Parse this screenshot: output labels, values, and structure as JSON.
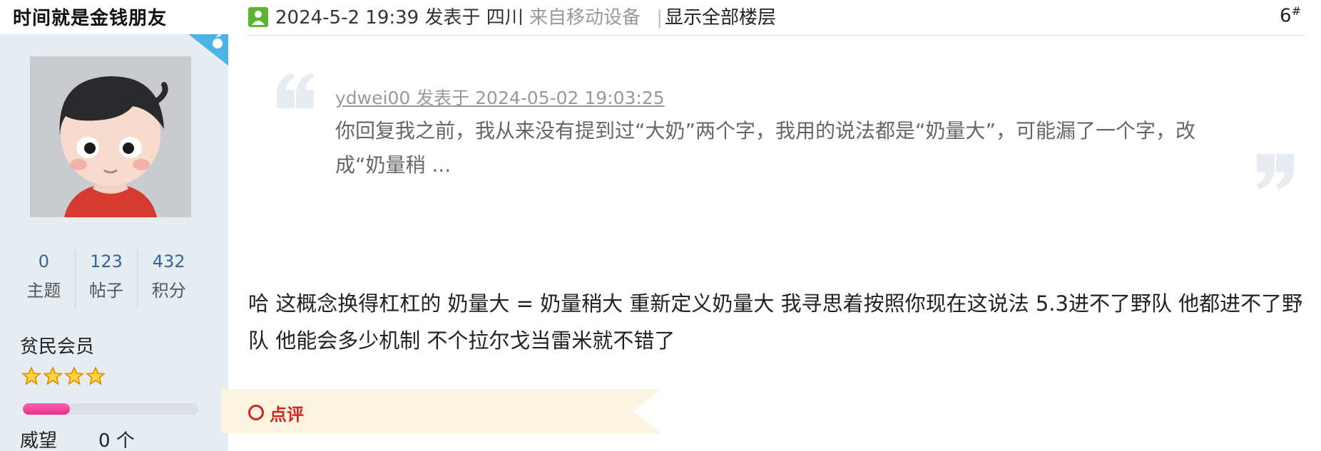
{
  "user": {
    "username": "时间就是金钱朋友",
    "stats": [
      {
        "value": "0",
        "label": "主题"
      },
      {
        "value": "123",
        "label": "帖子"
      },
      {
        "value": "432",
        "label": "积分"
      }
    ],
    "member_level": "贫民会员",
    "star_count": 4,
    "progress_fraction": 0.27,
    "prestige_label": "威望",
    "prestige_value": "0 个"
  },
  "post": {
    "date": "2024-5-2 19:39",
    "posted_in_label": "发表于 四川",
    "device": "来自移动设备",
    "separator": "|",
    "show_all_floors": "显示全部楼层",
    "floor_number": "6",
    "floor_symbol": "#"
  },
  "quote": {
    "author_line": "ydwei00 发表于 2024-05-02 19:03:25",
    "text": "你回复我之前，我从来没有提到过“大奶”两个字，我用的说法都是“奶量大”，可能漏了一个字，改成“奶量稍 ..."
  },
  "body_text": "哈 这概念换得杠杠的 奶量大 = 奶量稍大 重新定义奶量大 我寻思着按照你现在这说法 5.3进不了野队 他都进不了野队 他能会多少机制 不个拉尔戈当雷米就不错了",
  "comment_label": "点评",
  "colors": {
    "panel_bg": "#e5edf2",
    "stat_blue": "#336699",
    "accent_red": "#d6231e",
    "ribbon": "#fdf3e1",
    "progress_pink": "#e8308d"
  }
}
